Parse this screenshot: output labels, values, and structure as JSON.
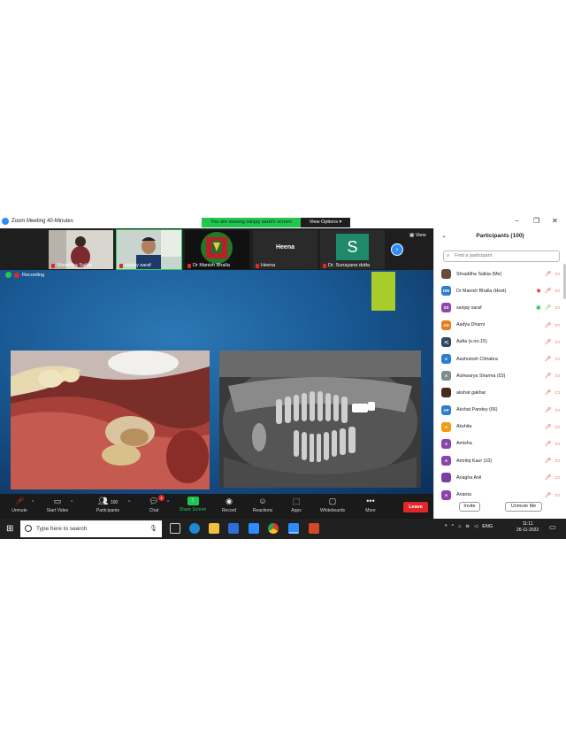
{
  "window": {
    "title": "Zoom Meeting 40-Minutes",
    "viewing_banner": "You are viewing sanjay saraf's screen",
    "view_options": "View Options",
    "minimize": "−",
    "restore": "❐",
    "close": "✕"
  },
  "gallery": {
    "tiles": [
      {
        "name": "Shraddha Saikia"
      },
      {
        "name": "sanjay saraf"
      },
      {
        "name": "Dr Manish Bhalla"
      },
      {
        "name": "Heena",
        "big_name": "Heena"
      },
      {
        "name": "Dr. Sunayana dutta",
        "initial": "S"
      }
    ],
    "view_label": "View",
    "next_glyph": "›"
  },
  "share": {
    "recording_label": "Recording"
  },
  "toolbar": {
    "unmute": "Unmute",
    "start_video": "Start Video",
    "participants": "Participants",
    "participants_count": "100",
    "chat": "Chat",
    "chat_badge": "1",
    "share_screen": "Share Screen",
    "record": "Record",
    "reactions": "Reactions",
    "apps": "Apps",
    "whiteboards": "Whiteboards",
    "more": "More",
    "leave": "Leave"
  },
  "panel": {
    "title": "Participants (100)",
    "search_placeholder": "Find a participant",
    "participants": [
      {
        "name": "Shraddha Saikia (Me)",
        "initials": "",
        "color": "#6b4a3a"
      },
      {
        "name": "Dr Manish Bhalla (Host)",
        "initials": "DM",
        "color": "#2d7dd2"
      },
      {
        "name": "sanjay saraf",
        "initials": "SS",
        "color": "#8e44ad"
      },
      {
        "name": "Aadya Dharni",
        "initials": "AD",
        "color": "#e67e22"
      },
      {
        "name": "Aafia (s.no-15)",
        "initials": "A(",
        "color": "#34495e"
      },
      {
        "name": "Aashutosh Chhabra",
        "initials": "A",
        "color": "#2d7dd2"
      },
      {
        "name": "Aishwarya Sharma (53)",
        "initials": "A",
        "color": "#7f8c8d"
      },
      {
        "name": "akshat gakhar",
        "initials": "",
        "color": "#4a2a1a"
      },
      {
        "name": "Akshat Pandey (66)",
        "initials": "AP",
        "color": "#2d7dd2"
      },
      {
        "name": "Akshita",
        "initials": "A",
        "color": "#f39c12"
      },
      {
        "name": "Amisha",
        "initials": "A",
        "color": "#8e44ad"
      },
      {
        "name": "Amritoj Kaur (10)",
        "initials": "A",
        "color": "#8e44ad"
      },
      {
        "name": "Anagha Anil",
        "initials": "",
        "color": "#7b3fa0"
      },
      {
        "name": "Ananta",
        "initials": "A",
        "color": "#8e44ad"
      }
    ],
    "invite": "Invite",
    "unmute_me": "Unmute Me"
  },
  "taskbar": {
    "search_placeholder": "Type here to search",
    "language": "ENG",
    "time": "11:11",
    "date": "26-11-2022"
  }
}
